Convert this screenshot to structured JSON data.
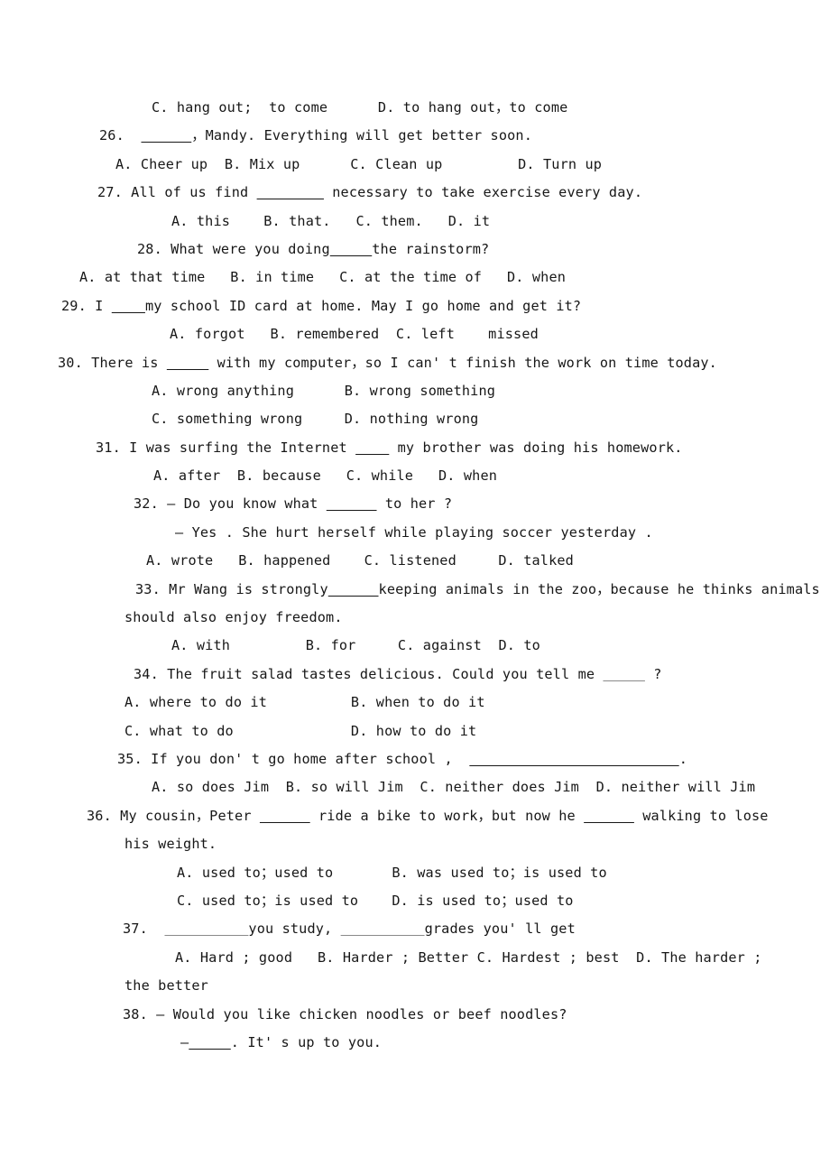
{
  "document": {
    "type": "exam-worksheet",
    "subject": "English grammar multiple choice",
    "page_background": "#ffffff",
    "text_color": "#171717",
    "question_range": "26-38"
  },
  "lines": [
    {
      "id": "l01",
      "indent": 168,
      "segments": [
        {
          "t": "C. hang out;  to come      D. to hang out，to come"
        }
      ]
    },
    {
      "id": "l02",
      "indent": 110,
      "segments": [
        {
          "t": "26.  "
        },
        {
          "t": "      ",
          "blank": true
        },
        {
          "t": "，Mandy. Everything will get better soon."
        }
      ]
    },
    {
      "id": "l03",
      "indent": 128,
      "segments": [
        {
          "t": "A. Cheer up  B. Mix up      C. Clean up         D. Turn up"
        }
      ]
    },
    {
      "id": "l04",
      "indent": 108,
      "segments": [
        {
          "t": "27. All of us find "
        },
        {
          "t": "        ",
          "blank": true
        },
        {
          "t": " necessary to take exercise every day."
        }
      ]
    },
    {
      "id": "l05",
      "indent": 190,
      "segments": [
        {
          "t": "A. this    B. that.   C. them.   D. it"
        }
      ]
    },
    {
      "id": "l06",
      "indent": 152,
      "segments": [
        {
          "t": "28. What were you doing"
        },
        {
          "t": "     ",
          "blank": true
        },
        {
          "t": "the rainstorm?"
        }
      ]
    },
    {
      "id": "l07",
      "indent": 88,
      "segments": [
        {
          "t": "A. at that time   B. in time   C. at the time of   D. when"
        }
      ]
    },
    {
      "id": "l08",
      "indent": 68,
      "segments": [
        {
          "t": "29. I "
        },
        {
          "t": "    ",
          "blank": true
        },
        {
          "t": "my school ID card at home. May I go home and get it?"
        }
      ]
    },
    {
      "id": "l09",
      "indent": 188,
      "segments": [
        {
          "t": "A. forgot   B. remembered  C. left    missed"
        }
      ]
    },
    {
      "id": "l10",
      "indent": 64,
      "segments": [
        {
          "t": "30. There is "
        },
        {
          "t": "     ",
          "blank": true
        },
        {
          "t": " with my computer，so I can' t finish the work on time today."
        }
      ]
    },
    {
      "id": "l11",
      "indent": 168,
      "segments": [
        {
          "t": "A. wrong anything      B. wrong something"
        }
      ]
    },
    {
      "id": "l12",
      "indent": 168,
      "segments": [
        {
          "t": "C. something wrong     D. nothing wrong"
        }
      ]
    },
    {
      "id": "l13",
      "indent": 106,
      "segments": [
        {
          "t": "31. I was surfing the Internet "
        },
        {
          "t": "    ",
          "blank": true
        },
        {
          "t": " my brother was doing his homework."
        }
      ]
    },
    {
      "id": "l14",
      "indent": 170,
      "segments": [
        {
          "t": "A. after  B. because   C. while   D. when"
        }
      ]
    },
    {
      "id": "l15",
      "indent": 148,
      "segments": [
        {
          "t": "32. — Do you know what "
        },
        {
          "t": "      ",
          "blank": true
        },
        {
          "t": " to her ?"
        }
      ]
    },
    {
      "id": "l16",
      "indent": 194,
      "segments": [
        {
          "t": "— Yes . She hurt herself while playing soccer yesterday ."
        }
      ]
    },
    {
      "id": "l17",
      "indent": 162,
      "segments": [
        {
          "t": "A. wrote   B. happened    C. listened     D. talked"
        }
      ]
    },
    {
      "id": "l18",
      "indent": 150,
      "segments": [
        {
          "t": "33. Mr Wang is strongly"
        },
        {
          "t": "      ",
          "blank": true
        },
        {
          "t": "keeping animals in the zoo，because he thinks animals"
        }
      ]
    },
    {
      "id": "l19",
      "indent": 138,
      "segments": [
        {
          "t": "should also enjoy freedom."
        }
      ]
    },
    {
      "id": "l20",
      "indent": 190,
      "segments": [
        {
          "t": "A. with         B. for     C. against  D. to"
        }
      ]
    },
    {
      "id": "l21",
      "indent": 148,
      "segments": [
        {
          "t": "34. The fruit salad tastes delicious. Could you tell me "
        },
        {
          "t": "     ",
          "blank": "faint"
        },
        {
          "t": " ?"
        }
      ]
    },
    {
      "id": "l22",
      "indent": 138,
      "segments": [
        {
          "t": "A. where to do it          B. when to do it"
        }
      ]
    },
    {
      "id": "l23",
      "indent": 138,
      "segments": [
        {
          "t": "C. what to do              D. how to do it"
        }
      ]
    },
    {
      "id": "l24",
      "indent": 130,
      "segments": [
        {
          "t": "35. If you don' t go home after school ,  "
        },
        {
          "t": "                         ",
          "blank": true
        },
        {
          "t": "."
        }
      ]
    },
    {
      "id": "l25",
      "indent": 168,
      "segments": [
        {
          "t": "A. so does Jim  B. so will Jim  C. neither does Jim  D. neither will Jim"
        }
      ]
    },
    {
      "id": "l26",
      "indent": 96,
      "segments": [
        {
          "t": "36. My cousin，Peter "
        },
        {
          "t": "      ",
          "blank": true
        },
        {
          "t": " ride a bike to work，but now he "
        },
        {
          "t": "      ",
          "blank": true
        },
        {
          "t": " walking to lose"
        }
      ]
    },
    {
      "id": "l27",
      "indent": 138,
      "segments": [
        {
          "t": "his weight."
        }
      ]
    },
    {
      "id": "l28",
      "indent": 196,
      "segments": [
        {
          "t": "A. used to；used to       B. was used to；is used to"
        }
      ]
    },
    {
      "id": "l29",
      "indent": 196,
      "segments": [
        {
          "t": "C. used to；is used to    D. is used to；used to"
        }
      ]
    },
    {
      "id": "l30",
      "indent": 136,
      "segments": [
        {
          "t": "37.  "
        },
        {
          "t": "          ",
          "blank": "faint"
        },
        {
          "t": "you study, "
        },
        {
          "t": "          ",
          "blank": "faint"
        },
        {
          "t": "grades you' ll get"
        }
      ]
    },
    {
      "id": "l31",
      "indent": 194,
      "segments": [
        {
          "t": "A. Hard ; good   B. Harder ; Better C. Hardest ; best  D. The harder ;"
        }
      ]
    },
    {
      "id": "l32",
      "indent": 138,
      "segments": [
        {
          "t": "the better"
        }
      ]
    },
    {
      "id": "l33",
      "indent": 136,
      "segments": [
        {
          "t": "38. — Would you like chicken noodles or beef noodles?"
        }
      ]
    },
    {
      "id": "l34",
      "indent": 200,
      "segments": [
        {
          "t": "—"
        },
        {
          "t": "     ",
          "blank": true
        },
        {
          "t": ". It' s up to you."
        }
      ]
    }
  ]
}
